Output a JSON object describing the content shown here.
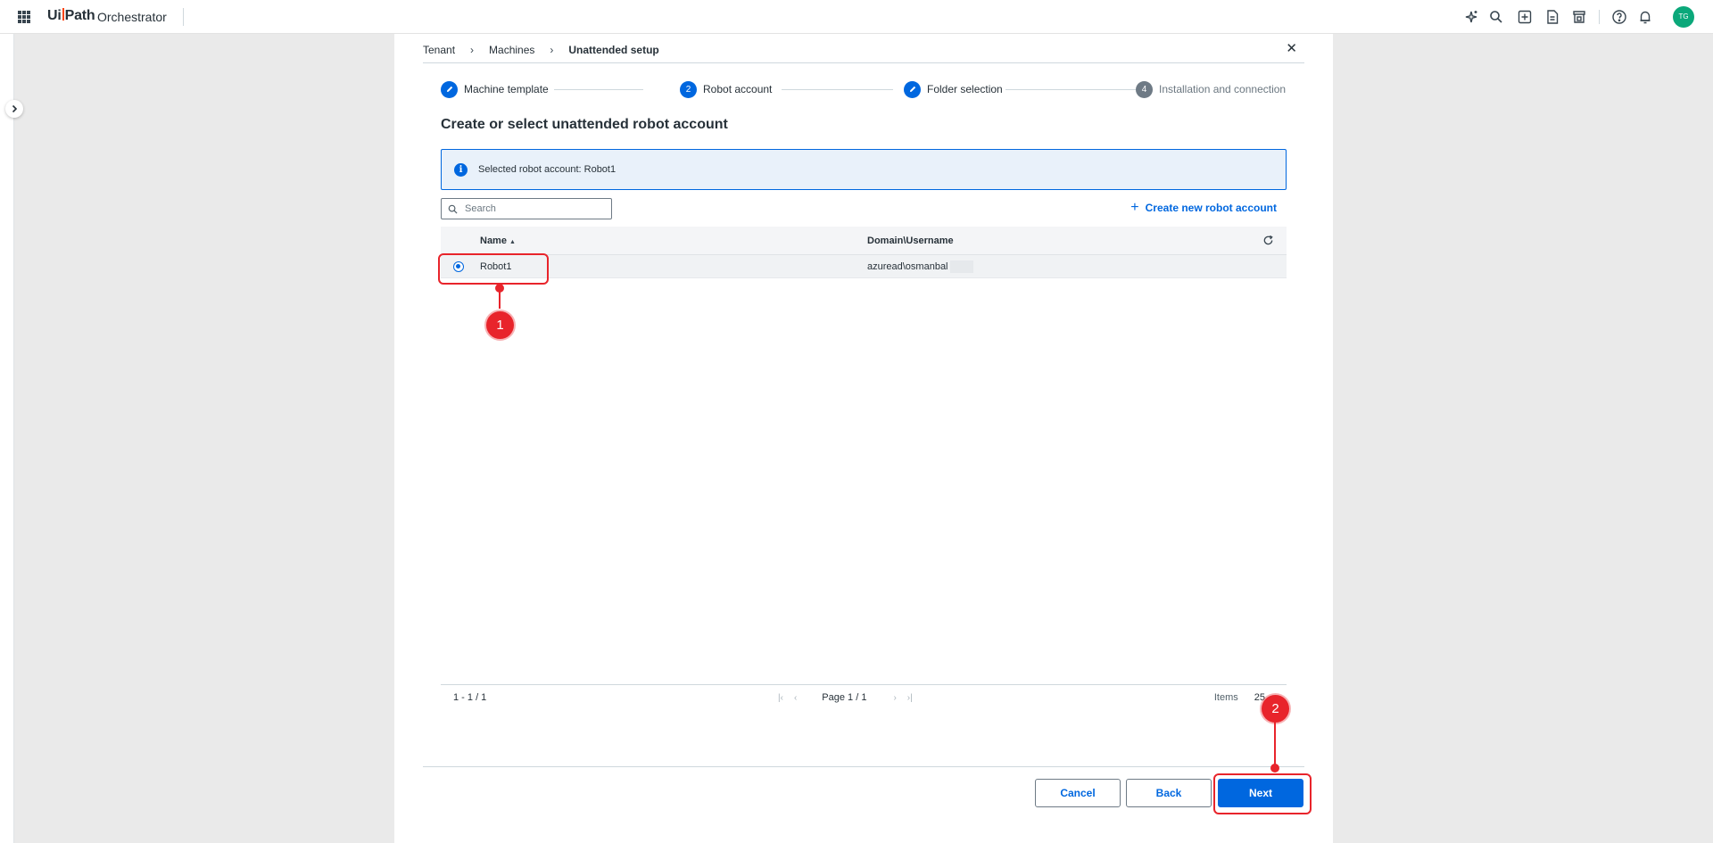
{
  "app": {
    "brand": "UiPath",
    "product": "Orchestrator",
    "avatar_initials": "TG",
    "accent": "#0067df"
  },
  "topbar": {
    "icons": [
      "autopilot-sparkle-icon",
      "search-icon",
      "add-icon",
      "document-icon",
      "store-icon",
      "help-icon",
      "bell-icon"
    ]
  },
  "breadcrumb": {
    "items": [
      "Tenant",
      "Machines",
      "Unattended setup"
    ]
  },
  "stepper": {
    "steps": [
      {
        "label": "Machine template",
        "marker": "edit"
      },
      {
        "label": "Robot account",
        "marker": "2"
      },
      {
        "label": "Folder selection",
        "marker": "edit"
      },
      {
        "label": "Installation and connection",
        "marker": "4"
      }
    ]
  },
  "page_title": "Create or select unattended robot account",
  "info": {
    "text": "Selected robot account: Robot1"
  },
  "search": {
    "placeholder": "Search",
    "value": ""
  },
  "create_link": "Create new robot account",
  "table": {
    "columns": [
      "Name",
      "Domain\\Username"
    ],
    "rows": [
      {
        "name": "Robot1",
        "domain_username": "azuread\\osmanbal",
        "selected": true
      }
    ]
  },
  "pagination": {
    "range": "1 - 1 / 1",
    "page": "Page 1 / 1",
    "items_label": "Items",
    "items_per_page": "25"
  },
  "buttons": {
    "cancel": "Cancel",
    "back": "Back",
    "next": "Next"
  },
  "annotations": {
    "badge_1": "1",
    "badge_2": "2",
    "color": "#e8242b"
  }
}
